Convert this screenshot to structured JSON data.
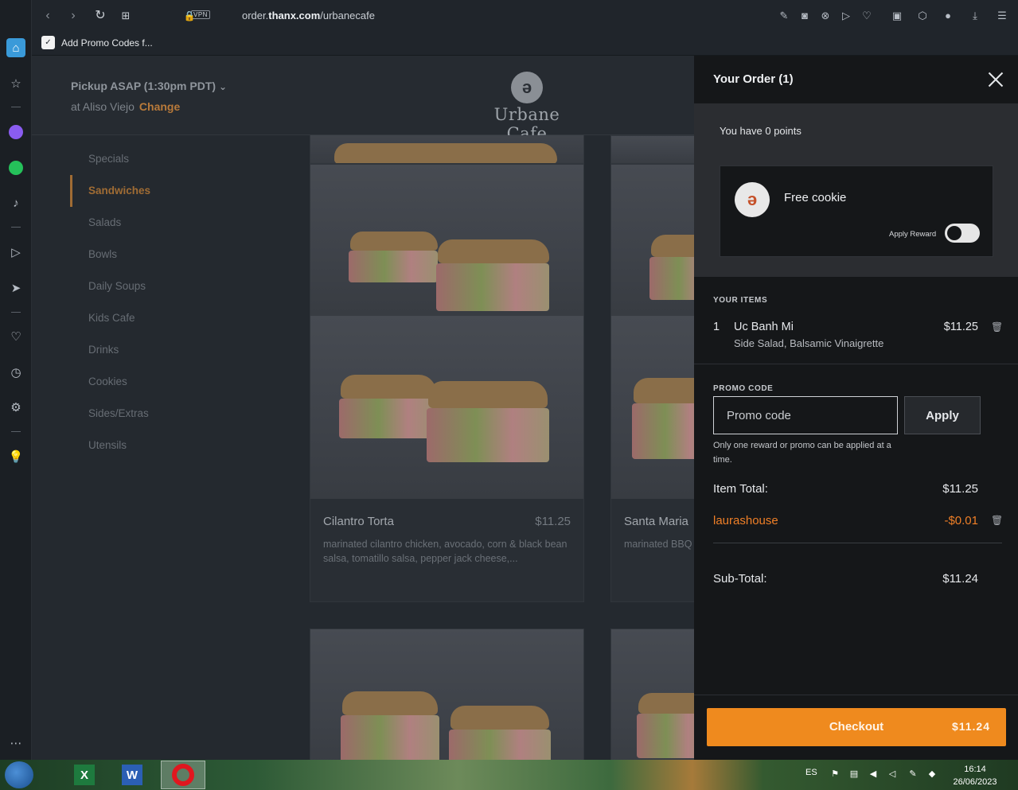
{
  "browser": {
    "url_prefix": "order.",
    "url_domain": "thanx.com",
    "url_path": "/urbanecafe",
    "vpn_label": "VPN",
    "bookmark_label": "Add Promo Codes f..."
  },
  "header": {
    "pickup_label": "Pickup ASAP (1:30pm PDT)",
    "location_prefix": "at Aliso Viejo",
    "change_label": "Change",
    "logo_text": "Urbane Cafe"
  },
  "categories": [
    "Specials",
    "Sandwiches",
    "Salads",
    "Bowls",
    "Daily Soups",
    "Kids Cafe",
    "Drinks",
    "Cookies",
    "Sides/Extras",
    "Utensils"
  ],
  "active_category": "Sandwiches",
  "products": [
    {
      "name": "Cilantro Torta",
      "price": "$11.25",
      "description": "marinated cilantro chicken, avocado, corn & black bean salsa, tomatillo salsa, pepper jack cheese,..."
    },
    {
      "name": "Santa Maria",
      "price": "",
      "description": "marinated BBQ bacon, chedda"
    }
  ],
  "order": {
    "title": "Your Order (1)",
    "points_text": "You have 0 points",
    "reward_name": "Free cookie",
    "apply_reward_label": "Apply Reward",
    "your_items_label": "YOUR ITEMS",
    "items": [
      {
        "qty": "1",
        "name": "Uc Banh Mi",
        "mods": "Side Salad, Balsamic Vinaigrette",
        "price": "$11.25"
      }
    ],
    "promo_label": "PROMO CODE",
    "promo_placeholder": "Promo code",
    "promo_apply": "Apply",
    "promo_note": "Only one reward or promo can be applied at a time.",
    "item_total_label": "Item Total:",
    "item_total_value": "$11.25",
    "promo_name": "laurashouse",
    "promo_value": "-$0.01",
    "subtotal_label": "Sub-Total:",
    "subtotal_value": "$11.24",
    "checkout_label": "Checkout",
    "checkout_amount": "$11.24",
    "accent_color": "#ef8a1e"
  },
  "taskbar": {
    "language": "ES",
    "time": "16:14",
    "date": "26/06/2023"
  }
}
